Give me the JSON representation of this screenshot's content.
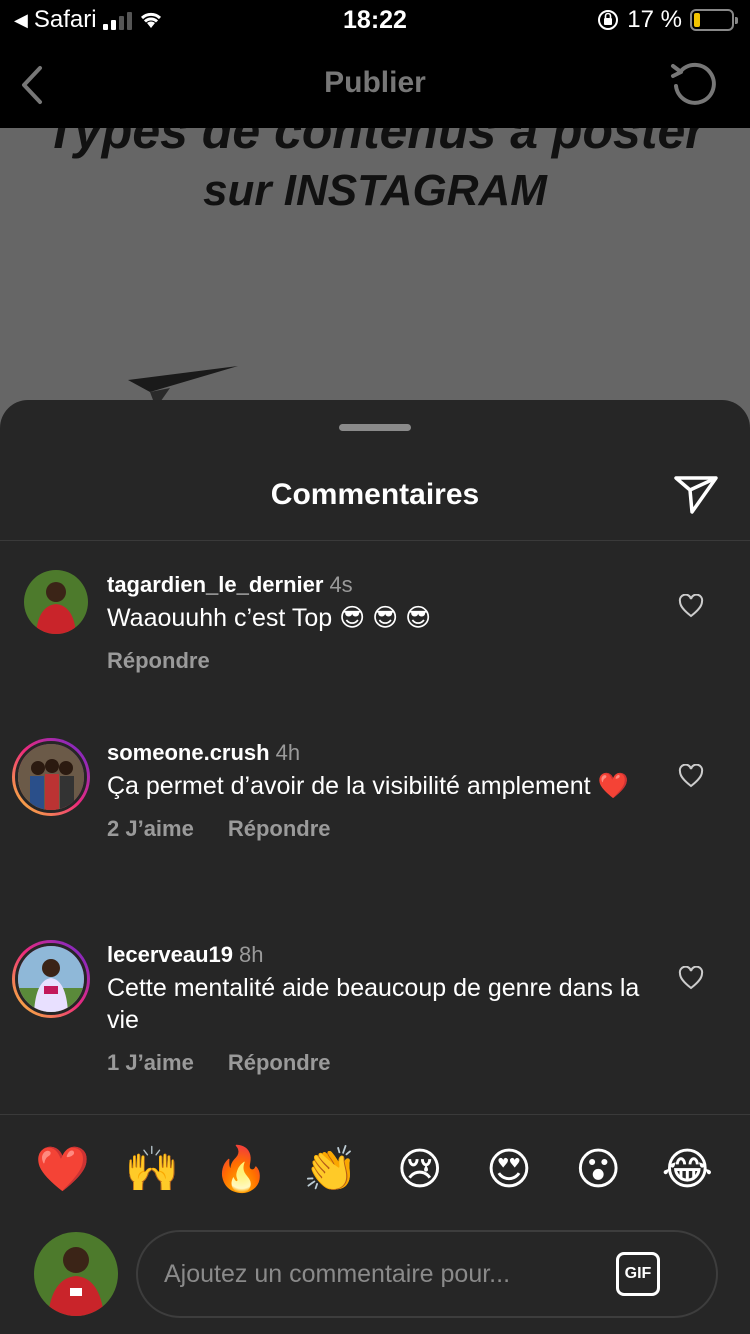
{
  "status_bar": {
    "back_app": "Safari",
    "time": "18:22",
    "battery_percent": "17 %",
    "battery_level": 0.17
  },
  "nav": {
    "title": "Publier",
    "back_icon": "chevron-left-icon",
    "refresh_icon": "refresh-icon"
  },
  "post": {
    "title_line1": "Types de contenus à poster",
    "title_line2": "sur INSTAGRAM"
  },
  "comments_sheet": {
    "title": "Commentaires",
    "share_icon": "send-icon",
    "comments": [
      {
        "username": "tagardien_le_dernier",
        "time": "4s",
        "text": "Waaouuhh c’est Top 😎 😎 😎",
        "likes_label": "",
        "reply_label": "Répondre"
      },
      {
        "username": "someone.crush",
        "time": "4h",
        "text": "Ça permet d’avoir de la visibilité amplement ❤️",
        "likes_label": "2 J’aime",
        "reply_label": "Répondre"
      },
      {
        "username": "lecerveau19",
        "time": "8h",
        "text": "Cette mentalité aide beaucoup de genre dans la vie",
        "likes_label": "1 J’aime",
        "reply_label": "Répondre"
      }
    ],
    "quick_reactions": [
      "❤️",
      "🙌",
      "🔥",
      "👏",
      "😢",
      "😍",
      "😮",
      "😂"
    ],
    "composer": {
      "placeholder": "Ajoutez un commentaire pour...",
      "gif_label": "GIF"
    }
  },
  "colors": {
    "sheet_bg": "#262626",
    "muted_text": "#9a9a9a",
    "story_ring": "#ee2a7b",
    "battery": "#f2c400"
  }
}
